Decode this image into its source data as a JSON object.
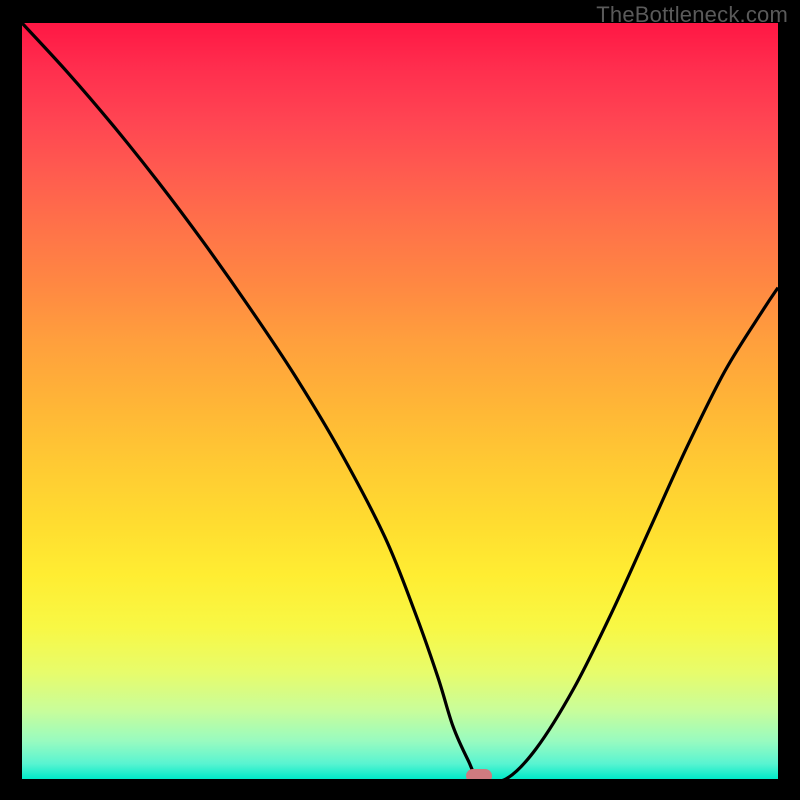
{
  "watermark": "TheBottleneck.com",
  "chart_data": {
    "type": "line",
    "title": "",
    "xlabel": "",
    "ylabel": "",
    "xlim": [
      0,
      100
    ],
    "ylim": [
      0,
      100
    ],
    "grid": false,
    "series": [
      {
        "name": "bottleneck-curve",
        "x": [
          0,
          6,
          12,
          18,
          24,
          30,
          36,
          42,
          48,
          52,
          55,
          57,
          59,
          60.5,
          64,
          68,
          73,
          78,
          83,
          88,
          93,
          98,
          100
        ],
        "y": [
          100,
          93.5,
          86.5,
          79,
          71,
          62.5,
          53.5,
          43.5,
          32,
          22,
          13.5,
          7,
          2.5,
          0,
          0,
          4,
          12,
          22,
          33,
          44,
          54,
          62,
          65
        ]
      }
    ],
    "marker": {
      "x": 60.5,
      "y": 0
    },
    "gradient_stops": [
      {
        "pos": 0,
        "color": "#FF1744"
      },
      {
        "pos": 50,
        "color": "#FFB437"
      },
      {
        "pos": 80,
        "color": "#F8F845"
      },
      {
        "pos": 100,
        "color": "#00E9C8"
      }
    ]
  }
}
